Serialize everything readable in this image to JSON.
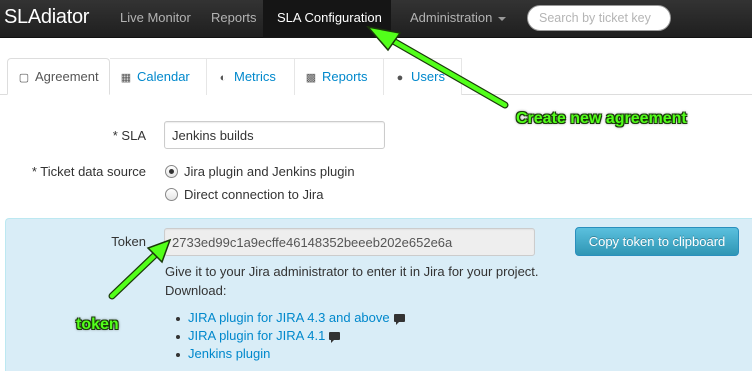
{
  "navbar": {
    "brand": "SLAdiator",
    "links": [
      "Live Monitor",
      "Reports"
    ],
    "active": "SLA Configuration",
    "admin": "Administration",
    "search_placeholder": "Search by ticket key"
  },
  "tabs": [
    {
      "label": "Agreement",
      "icon": "document-icon",
      "active": true
    },
    {
      "label": "Calendar",
      "icon": "calendar-icon",
      "active": false
    },
    {
      "label": "Metrics",
      "icon": "contrast-icon",
      "active": false
    },
    {
      "label": "Reports",
      "icon": "folder-icon",
      "active": false
    },
    {
      "label": "Users",
      "icon": "user-icon",
      "active": false
    }
  ],
  "form": {
    "sla_label": "* SLA",
    "sla_value": "Jenkins builds",
    "source_label": "* Ticket data source",
    "source_options": [
      {
        "label": "Jira plugin and Jenkins plugin",
        "checked": true
      },
      {
        "label": "Direct connection to Jira",
        "checked": false
      }
    ]
  },
  "token": {
    "label": "Token",
    "value": "2733ed99c1a9ecffe46148352beeeb202e652e6a",
    "copy_button": "Copy token to clipboard",
    "info": "Give it to your Jira administrator to enter it in Jira for your project.",
    "download_label": "Download:",
    "downloads": [
      {
        "label": "JIRA plugin for JIRA 4.3 and above",
        "comment_icon": true
      },
      {
        "label": "JIRA plugin for JIRA 4.1",
        "comment_icon": true
      },
      {
        "label": "Jenkins plugin",
        "comment_icon": false
      }
    ]
  },
  "annotations": {
    "create": "Create new agreement",
    "token": "token",
    "color": "#52ff1a"
  },
  "colors": {
    "navbar": "#222222",
    "link": "#0088cc",
    "panel": "#d9edf7",
    "button": "#49afcd"
  }
}
